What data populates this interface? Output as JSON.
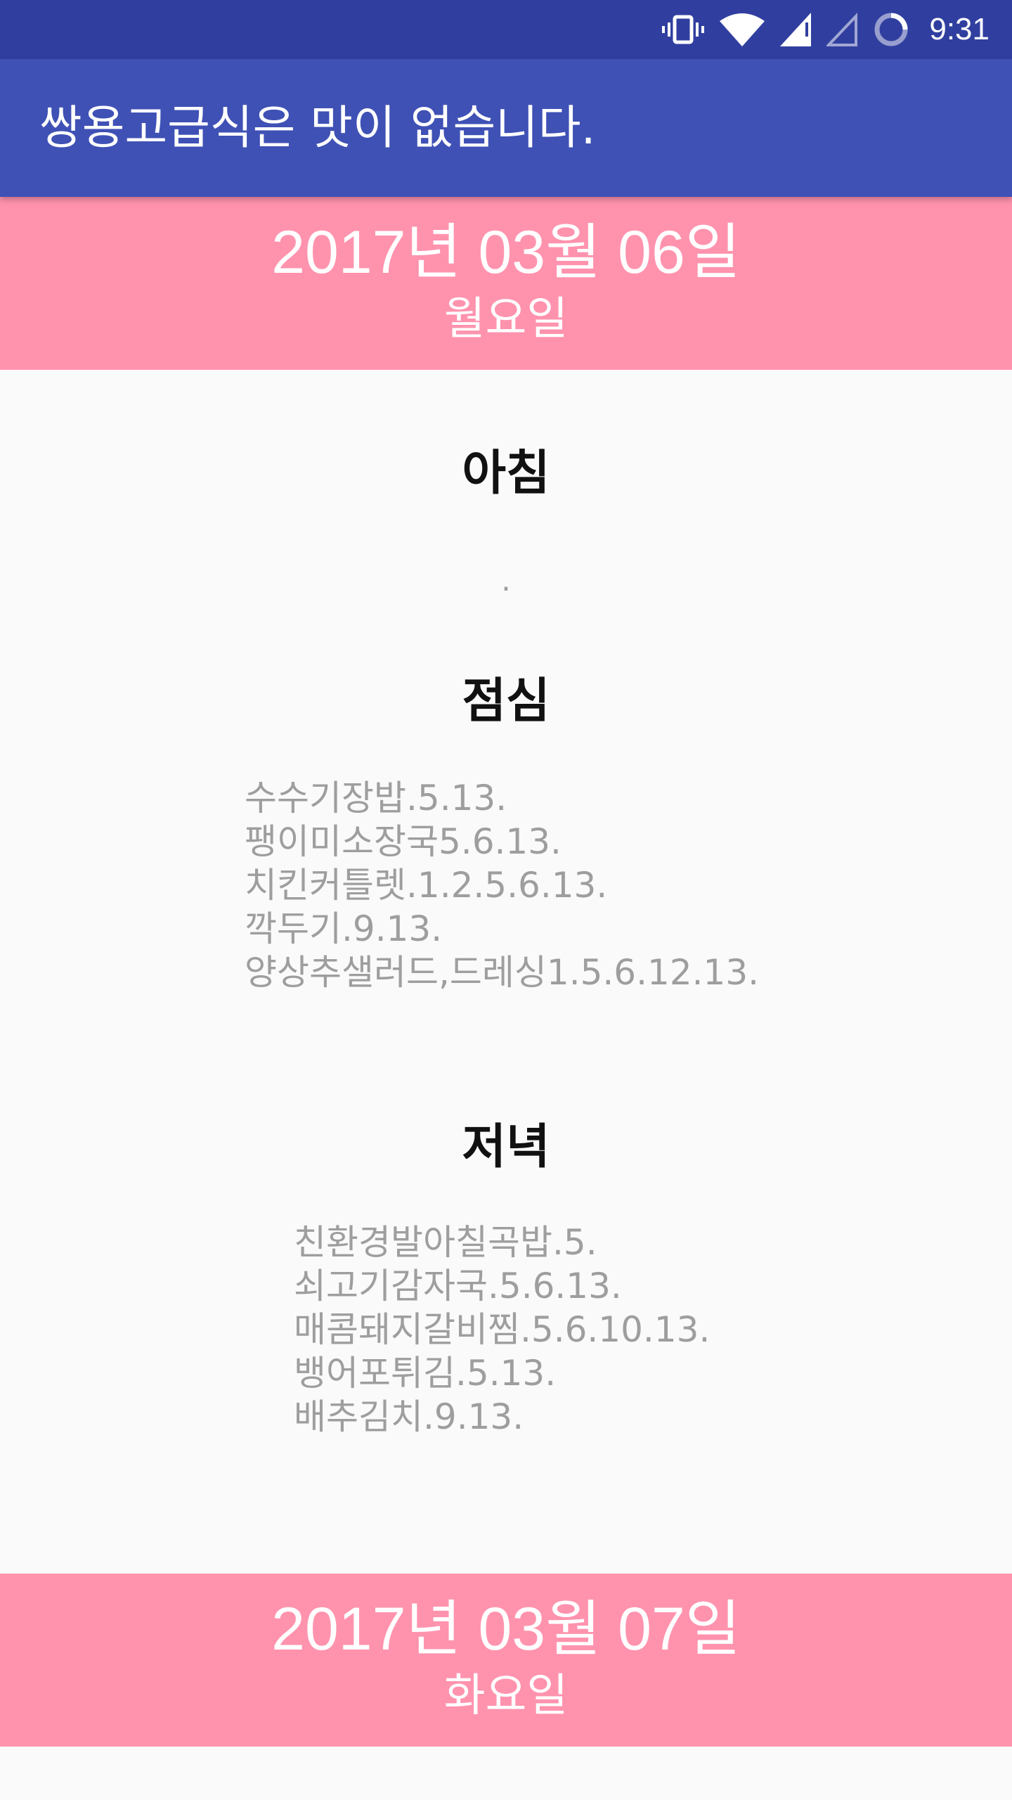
{
  "status_bar": {
    "time": "9:31",
    "icons": [
      "vibrate-icon",
      "wifi-icon",
      "signal-icon",
      "signal-empty-icon",
      "battery-charging-icon"
    ]
  },
  "app_bar": {
    "title": "쌍용고급식은 맛이 없습니다."
  },
  "colors": {
    "status_bar": "#303f9f",
    "app_bar": "#3f51b5",
    "day_header": "#ff93ae",
    "menu_text": "#9e9e9e"
  },
  "days": [
    {
      "date": "2017년 03월 06일",
      "weekday": "월요일",
      "meals": {
        "breakfast": {
          "title": "아침",
          "items": [
            "."
          ]
        },
        "lunch": {
          "title": "점심",
          "items": [
            "수수기장밥.5.13.",
            "팽이미소장국5.6.13.",
            "치킨커틀렛.1.2.5.6.13.",
            "깍두기.9.13.",
            "양상추샐러드,드레싱1.5.6.12.13."
          ]
        },
        "dinner": {
          "title": "저녁",
          "items": [
            "친환경발아칠곡밥.5.",
            "쇠고기감자국.5.6.13.",
            "매콤돼지갈비찜.5.6.10.13.",
            "뱅어포튀김.5.13.",
            "배추김치.9.13."
          ]
        }
      }
    },
    {
      "date": "2017년 03월 07일",
      "weekday": "화요일"
    }
  ]
}
